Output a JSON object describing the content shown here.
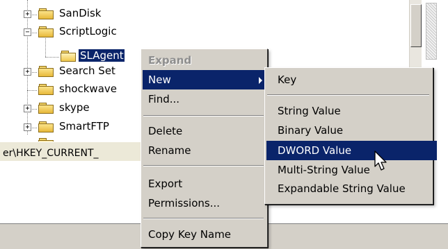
{
  "tree": {
    "items": [
      {
        "label": "SanDisk",
        "expander": "+"
      },
      {
        "label": "ScriptLogic",
        "expander": "−"
      },
      {
        "label": "SLAgent",
        "expander": "",
        "selected": true
      },
      {
        "label": "Search Set",
        "expander": "+"
      },
      {
        "label": "shockwave",
        "expander": ""
      },
      {
        "label": "skype",
        "expander": "+"
      },
      {
        "label": "SmartFTP",
        "expander": "+"
      }
    ]
  },
  "statusbar": {
    "path": "er\\HKEY_CURRENT_"
  },
  "context_menu": {
    "items": [
      {
        "label": "Expand",
        "state": "disabled"
      },
      {
        "label": "New",
        "state": "highlighted",
        "submenu": true
      },
      {
        "label": "Find...",
        "state": "normal"
      },
      {
        "label": "Delete",
        "state": "normal"
      },
      {
        "label": "Rename",
        "state": "normal"
      },
      {
        "label": "Export",
        "state": "normal"
      },
      {
        "label": "Permissions...",
        "state": "normal"
      },
      {
        "label": "Copy Key Name",
        "state": "normal"
      }
    ]
  },
  "new_submenu": {
    "items": [
      {
        "label": "Key",
        "state": "normal"
      },
      {
        "label": "String Value",
        "state": "normal"
      },
      {
        "label": "Binary Value",
        "state": "normal"
      },
      {
        "label": "DWORD Value",
        "state": "highlighted"
      },
      {
        "label": "Multi-String Value",
        "state": "normal"
      },
      {
        "label": "Expandable String Value",
        "state": "normal"
      }
    ]
  },
  "colors": {
    "highlight": "#0a246a",
    "menu_face": "#d4d0c8",
    "folder": "#f5d66b"
  },
  "icons": [
    "folder-icon",
    "open-folder-icon",
    "expand-icon",
    "collapse-icon",
    "submenu-arrow-icon",
    "mouse-pointer-icon"
  ]
}
